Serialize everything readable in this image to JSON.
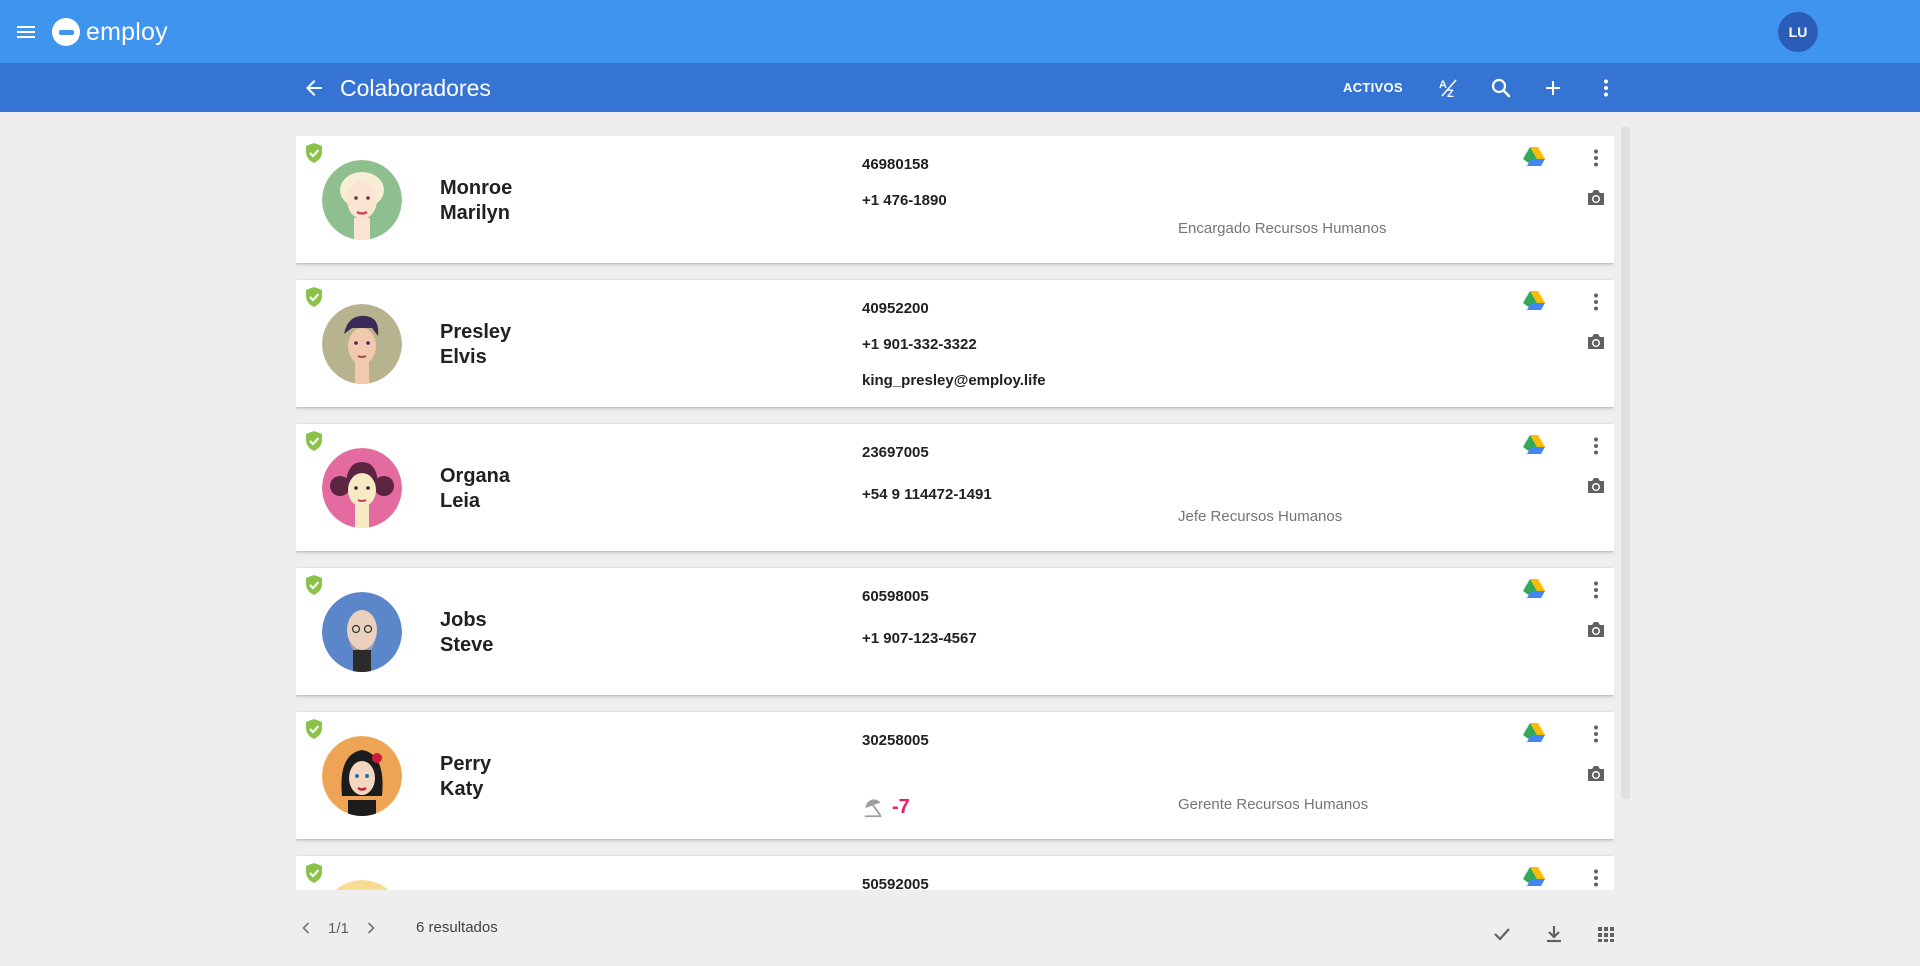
{
  "app": {
    "brand": "employ",
    "user_initials": "LU"
  },
  "header": {
    "title": "Colaboradores",
    "filter_label": "ACTIVOS"
  },
  "cards": [
    {
      "last": "Monroe",
      "first": "Marilyn",
      "id": "46980158",
      "phone": "+1 476-1890",
      "email": "",
      "role": "Encargado Recursos Humanos",
      "avatar_color": "#8fbf8f"
    },
    {
      "last": "Presley",
      "first": "Elvis",
      "id": "40952200",
      "phone": "+1 901-332-3322",
      "email": "king_presley@employ.life",
      "role": "",
      "avatar_color": "#b7b38e"
    },
    {
      "last": "Organa",
      "first": "Leia",
      "id": "23697005",
      "phone": "+54 9 114472-1491",
      "email": "",
      "role": "Jefe Recursos Humanos",
      "avatar_color": "#e36b9f"
    },
    {
      "last": "Jobs",
      "first": "Steve",
      "id": "60598005",
      "phone": "+1 907-123-4567",
      "email": "",
      "role": "",
      "avatar_color": "#5b86c9"
    },
    {
      "last": "Perry",
      "first": "Katy",
      "id": "30258005",
      "phone": "",
      "email": "",
      "role": "Gerente Recursos Humanos",
      "vacation": "-7",
      "avatar_color": "#eea455"
    },
    {
      "last": "",
      "first": "",
      "id": "50592005",
      "phone": "",
      "email": "",
      "role": "",
      "avatar_color": "#f6dd93"
    }
  ],
  "footer": {
    "page": "1/1",
    "results": "6 resultados"
  },
  "colors": {
    "topbar": "#3f95ee",
    "subbar": "#3574d3",
    "shield": "#8bc34a",
    "vacation": "#e91e63"
  }
}
